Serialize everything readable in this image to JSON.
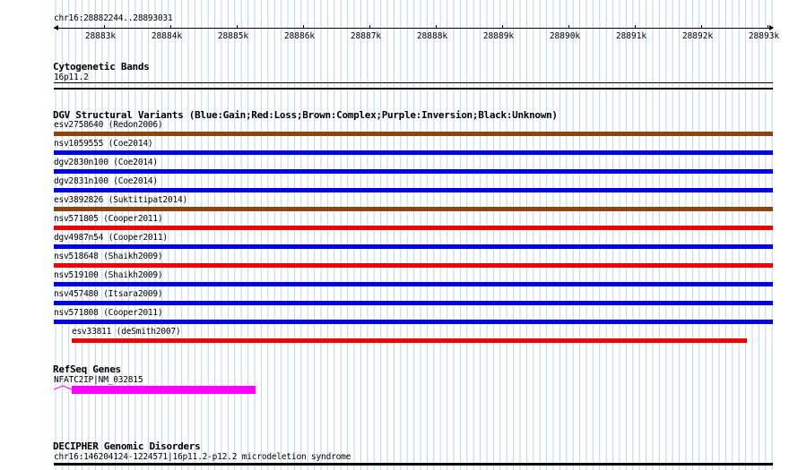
{
  "ruler": {
    "position_label": "chr16:28882244..28893031",
    "ticks": [
      "28883k",
      "28884k",
      "28885k",
      "28886k",
      "28887k",
      "28888k",
      "28889k",
      "28890k",
      "28891k",
      "28892k",
      "28893k"
    ]
  },
  "cytoband": {
    "title": "Cytogenetic Bands",
    "band_label": "16p11.2"
  },
  "dgv": {
    "title": "DGV Structural Variants (Blue:Gain;Red:Loss;Brown:Complex;Purple:Inversion;Black:Unknown)",
    "colors": {
      "gain": "#0000e6",
      "loss": "#f00000",
      "complex": "#8b4513"
    },
    "variants": [
      {
        "label": "esv2758640 (Redon2006)",
        "type": "complex"
      },
      {
        "label": "nsv1059555 (Coe2014)",
        "type": "gain"
      },
      {
        "label": "dgv2830n100 (Coe2014)",
        "type": "gain"
      },
      {
        "label": "dgv2831n100 (Coe2014)",
        "type": "gain"
      },
      {
        "label": "esv3892826 (Suktitipat2014)",
        "type": "complex"
      },
      {
        "label": "nsv571805 (Cooper2011)",
        "type": "loss"
      },
      {
        "label": "dgv4987n54 (Cooper2011)",
        "type": "gain"
      },
      {
        "label": "nsv518648 (Shaikh2009)",
        "type": "loss"
      },
      {
        "label": "nsv519100 (Shaikh2009)",
        "type": "gain"
      },
      {
        "label": "nsv457480 (Itsara2009)",
        "type": "gain"
      },
      {
        "label": "nsv571808 (Cooper2011)",
        "type": "gain"
      },
      {
        "label": "esv33811 (deSmith2007)",
        "type": "loss"
      }
    ]
  },
  "refseq": {
    "title": "RefSeq Genes",
    "gene_label": "NFATC2IP|NM_032815",
    "gene_color": "#ff00ff"
  },
  "decipher": {
    "title": "DECIPHER Genomic Disorders",
    "disorder_label": "chr16:146204124-1224571|16p11.2-p12.2 microdeletion syndrome"
  }
}
